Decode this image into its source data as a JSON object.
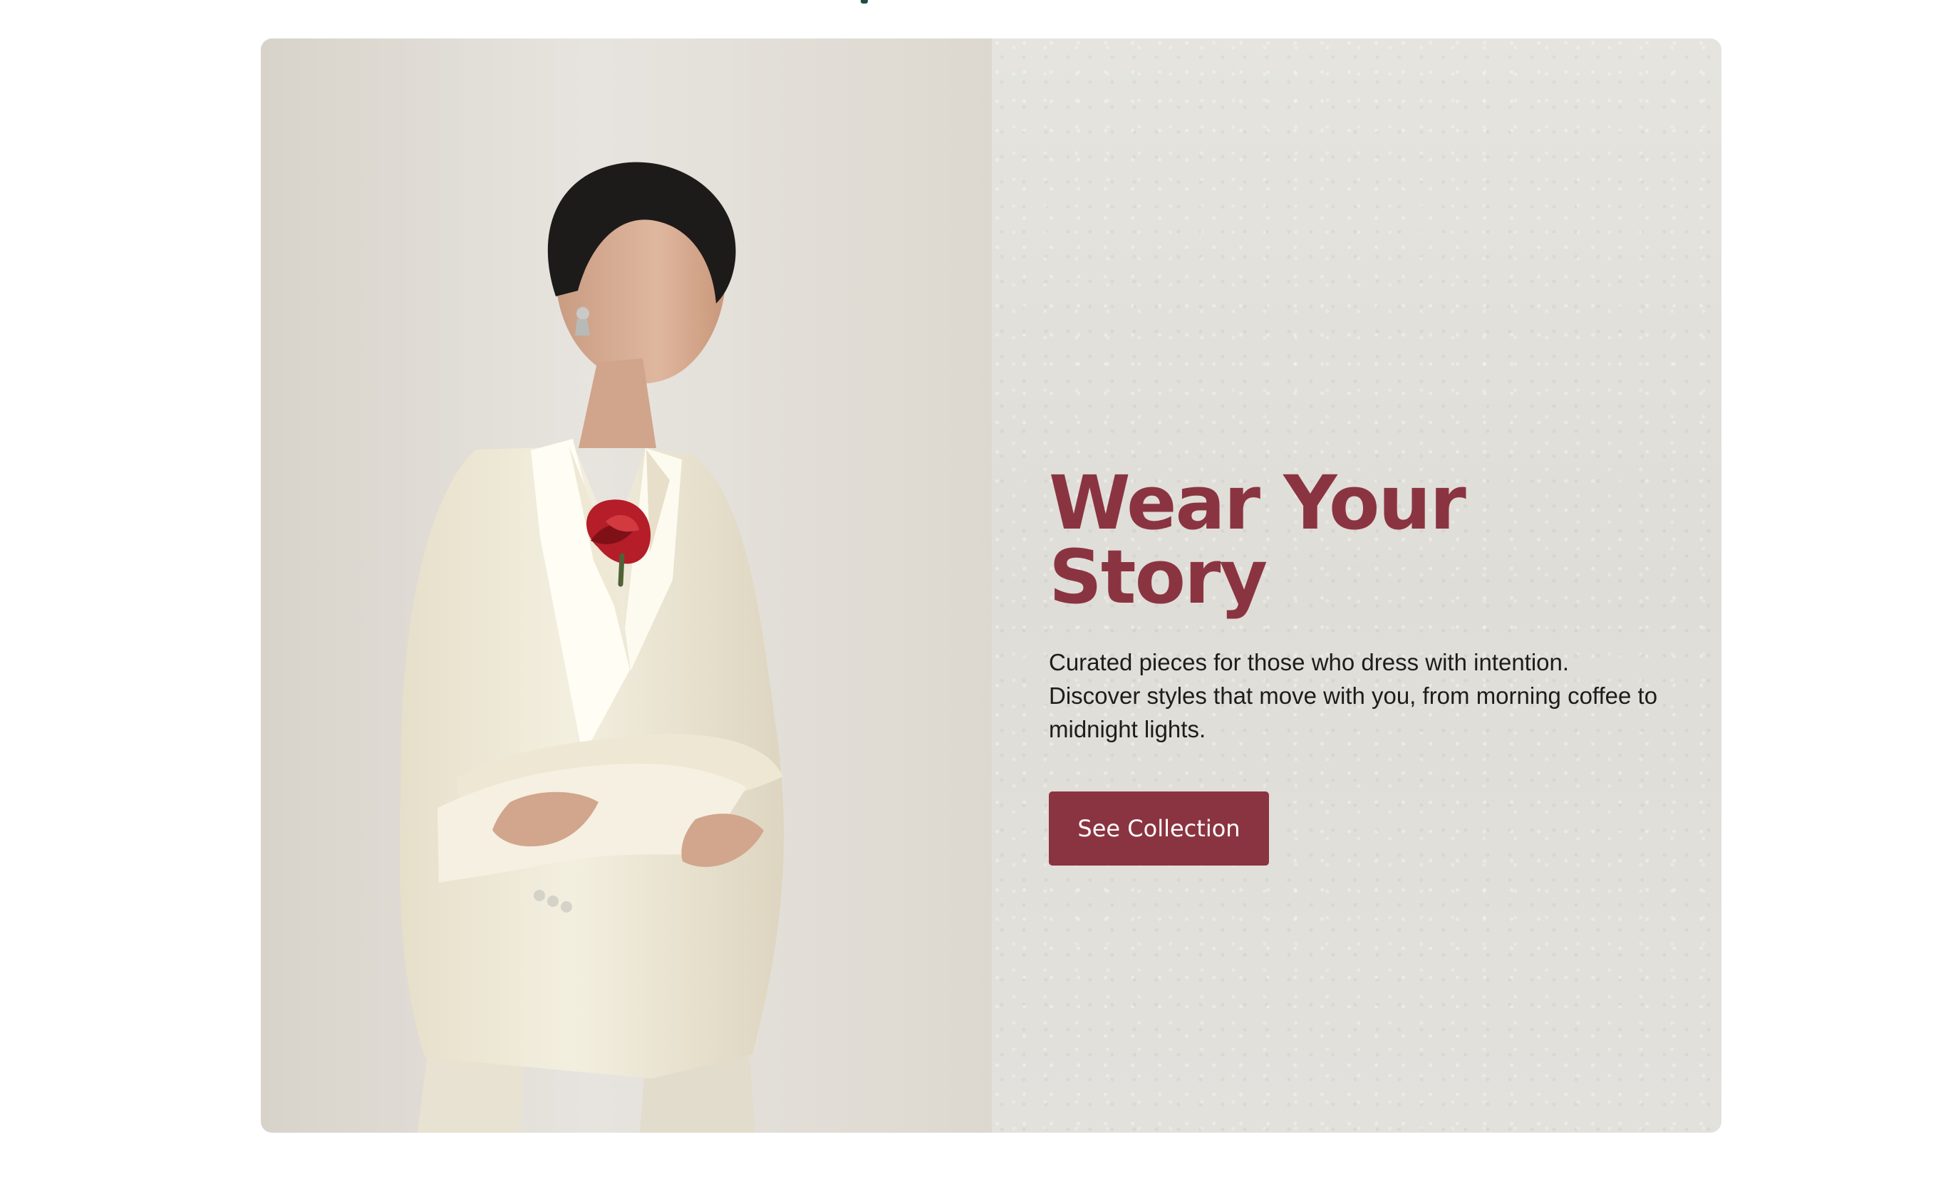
{
  "hero": {
    "title": "Wear Your Story",
    "description": "Curated pieces for those who dress with intention. Discover styles that move with you, from morning coffee to midnight lights.",
    "button_label": "See Collection"
  },
  "colors": {
    "accent": "#8b3441",
    "top_mark": "#1e4d49",
    "panel_background": "#e3e2dd",
    "suit": "#f3efdf",
    "rose": "#b51d29"
  },
  "image": {
    "subject": "fashion-model-in-cream-suit-with-red-rose"
  }
}
